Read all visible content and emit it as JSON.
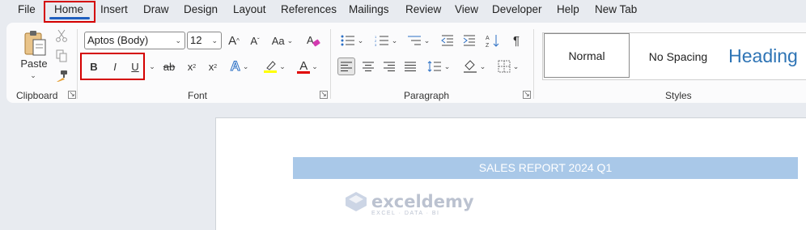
{
  "menu": {
    "tabs": [
      "File",
      "Home",
      "Insert",
      "Draw",
      "Design",
      "Layout",
      "References",
      "Mailings",
      "Review",
      "View",
      "Developer",
      "Help",
      "New Tab"
    ]
  },
  "clipboard": {
    "paste_label": "Paste",
    "group_label": "Clipboard"
  },
  "font": {
    "font_name": "Aptos (Body)",
    "font_size": "12",
    "bold": "B",
    "italic": "I",
    "underline": "U",
    "strike": "ab",
    "subscript": "x",
    "superscript": "x",
    "case_btn": "Aa",
    "text_effects": "A",
    "font_color_letter": "A",
    "highlight_color": "#ffff00",
    "font_color": "#e00000",
    "group_label": "Font"
  },
  "paragraph": {
    "group_label": "Paragraph",
    "pilcrow": "¶"
  },
  "styles": {
    "items": [
      "Normal",
      "No Spacing",
      "Heading"
    ],
    "heading_color": "#2e74b5",
    "group_label": "Styles"
  },
  "document": {
    "title": "SALES REPORT 2024 Q1",
    "title_band_color": "#a9c8e8"
  },
  "watermark": {
    "name": "exceldemy",
    "tagline": "EXCEL · DATA · BI"
  }
}
